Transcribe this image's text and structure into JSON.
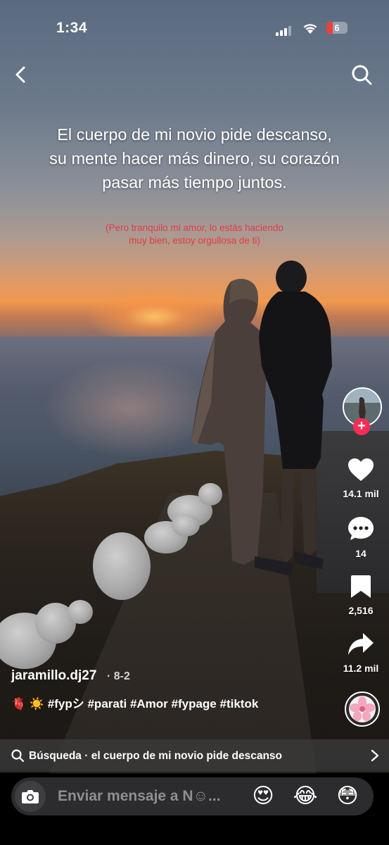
{
  "status_bar": {
    "time": "1:34",
    "battery": "6",
    "battery_color": "#e6433a"
  },
  "top_bar": {
    "back_icon": "chevron-left-icon",
    "search_icon": "search-icon"
  },
  "video_overlay": {
    "main_text": "El cuerpo de mi novio pide descanso, su mente hacer más dinero, su corazón pasar más tiempo juntos.",
    "sub_text": "(Pero tranquilo mi amor, lo estás haciendo muy bien, estoy orgullosa de ti)",
    "sub_text_color": "#e33a4a"
  },
  "actions": {
    "likes": "14.1 mil",
    "comments": "14",
    "saves": "2,516",
    "shares": "11.2 mil",
    "follow_color": "#fe2c55"
  },
  "post": {
    "author": "jaramillo.dj27",
    "date": "· 8-2",
    "caption_emojis": "🫀 ☀️",
    "caption_text": "#fypシ #parati #Amor #fypage #tiktok"
  },
  "search_suggestion": {
    "label": "Búsqueda · el cuerpo de mi novio pide descanso"
  },
  "message_bar": {
    "placeholder": "Enviar mensaje a N☺...",
    "emojis": [
      "😍",
      "😂",
      "😳"
    ]
  }
}
